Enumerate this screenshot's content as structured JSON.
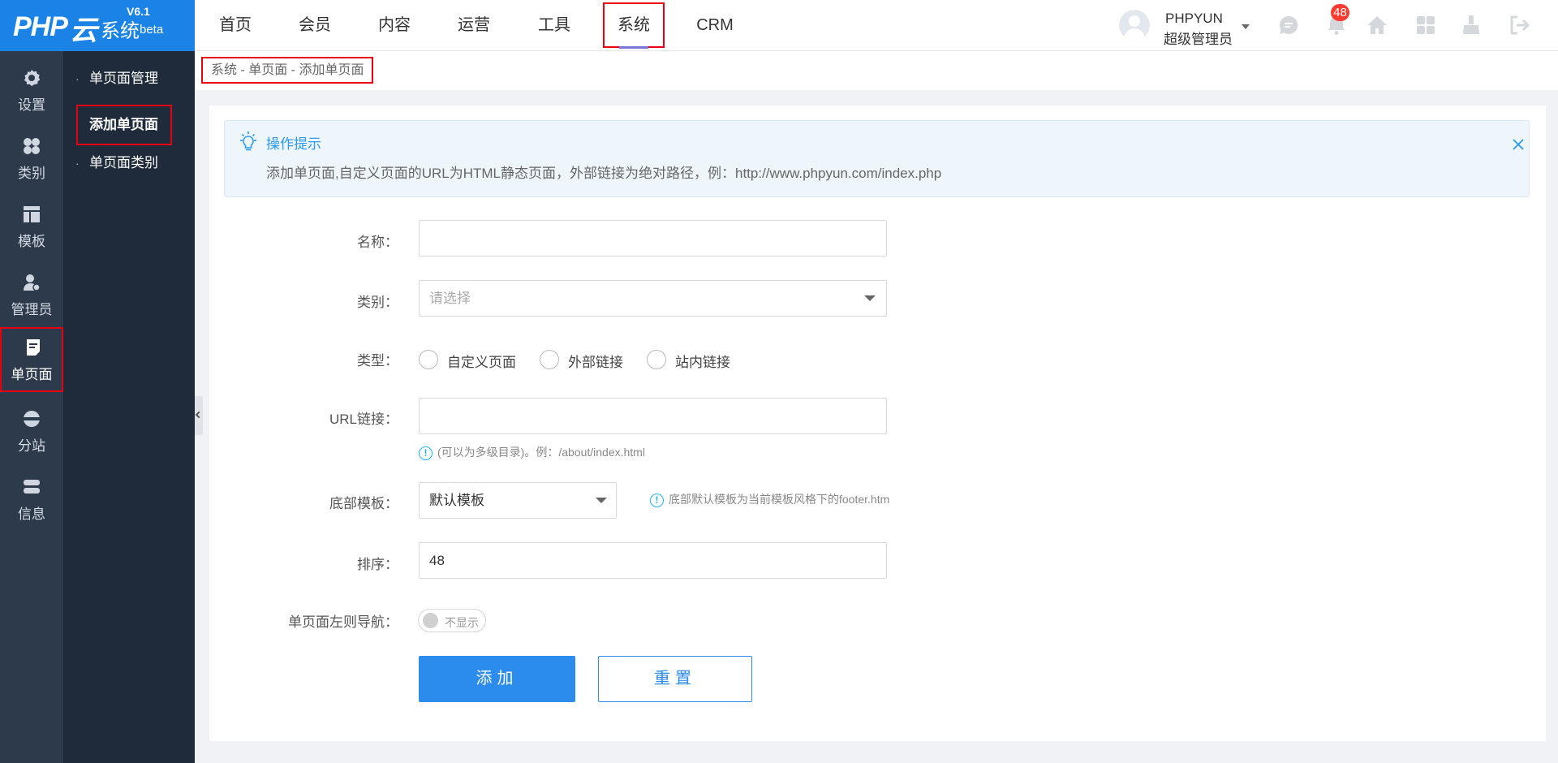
{
  "logo": {
    "brand": "PHP",
    "yun": "云",
    "system": "系统",
    "version": "V6.1",
    "edition": "beta"
  },
  "topnav": {
    "items": [
      "首页",
      "会员",
      "内容",
      "运营",
      "工具",
      "系统",
      "CRM"
    ],
    "active": "系统"
  },
  "user": {
    "name": "PHPYUN",
    "role": "超级管理员"
  },
  "toolbar": {
    "icons": [
      "chat-icon",
      "bell-icon",
      "home-icon",
      "apps-icon",
      "broom-icon",
      "logout-icon"
    ],
    "notification_count": "48",
    "badge_color": "#ff3b30"
  },
  "sidebar": {
    "items": [
      "设置",
      "类别",
      "模板",
      "管理员",
      "单页面",
      "分站",
      "信息"
    ],
    "active": "单页面"
  },
  "subnav": {
    "items": [
      "单页面管理",
      "添加单页面",
      "单页面类别"
    ],
    "active": "添加单页面"
  },
  "breadcrumb": {
    "text": "系统 - 单页面 - 添加单页面"
  },
  "tip": {
    "title": "操作提示",
    "text": "添加单页面,自定义页面的URL为HTML静态页面，外部链接为绝对路径，例：http://www.phpyun.com/index.php"
  },
  "form": {
    "name_label": "名称：",
    "name_value": "",
    "category_label": "类别：",
    "category_placeholder": "请选择",
    "type_label": "类型：",
    "type_options": [
      "自定义页面",
      "外部链接",
      "站内链接"
    ],
    "url_label": "URL链接：",
    "url_value": "",
    "url_hint": "(可以为多级目录)。例：/about/index.html",
    "footer_label": "底部模板：",
    "footer_value": "默认模板",
    "footer_hint": "底部默认模板为当前模板风格下的footer.htm",
    "sort_label": "排序：",
    "sort_value": "48",
    "nav_label": "单页面左则导航：",
    "nav_switch_label": "不显示",
    "add_button": "添加",
    "reset_button": "重置"
  },
  "colors": {
    "brand_blue": "#1b82e6",
    "primary": "#2b8ced",
    "highlight_red": "#e60012",
    "sidebar_dark": "#2d3a4b"
  }
}
